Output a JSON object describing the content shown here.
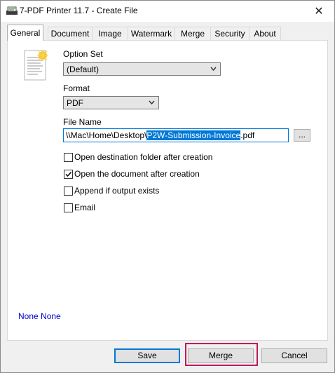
{
  "window": {
    "title": "7-PDF Printer 11.7 - Create File"
  },
  "tabs": [
    {
      "label": "General",
      "active": true
    },
    {
      "label": "Document"
    },
    {
      "label": "Image"
    },
    {
      "label": "Watermark"
    },
    {
      "label": "Merge"
    },
    {
      "label": "Security"
    },
    {
      "label": "About"
    }
  ],
  "general": {
    "option_set_label": "Option Set",
    "option_set_value": "(Default)",
    "format_label": "Format",
    "format_value": "PDF",
    "file_name_label": "File Name",
    "file_name_prefix": "\\\\Mac\\Home\\Desktop\\",
    "file_name_selected": "P2W-Submission-Invoice",
    "file_name_suffix": ".pdf",
    "browse_label": "...",
    "checkboxes": [
      {
        "label": "Open destination folder after creation",
        "checked": false
      },
      {
        "label": "Open the document after creation",
        "checked": true
      },
      {
        "label": "Append if output exists",
        "checked": false
      },
      {
        "label": "Email",
        "checked": false
      }
    ],
    "status_text": "None None"
  },
  "buttons": {
    "save": "Save",
    "merge": "Merge",
    "cancel": "Cancel"
  },
  "colors": {
    "accent": "#0078d7",
    "status_text": "#0000c8",
    "highlight": "#c2185b"
  },
  "icons": {
    "app": "printer-icon",
    "document": "document-icon",
    "close": "close-icon",
    "check": "checkmark-icon"
  }
}
